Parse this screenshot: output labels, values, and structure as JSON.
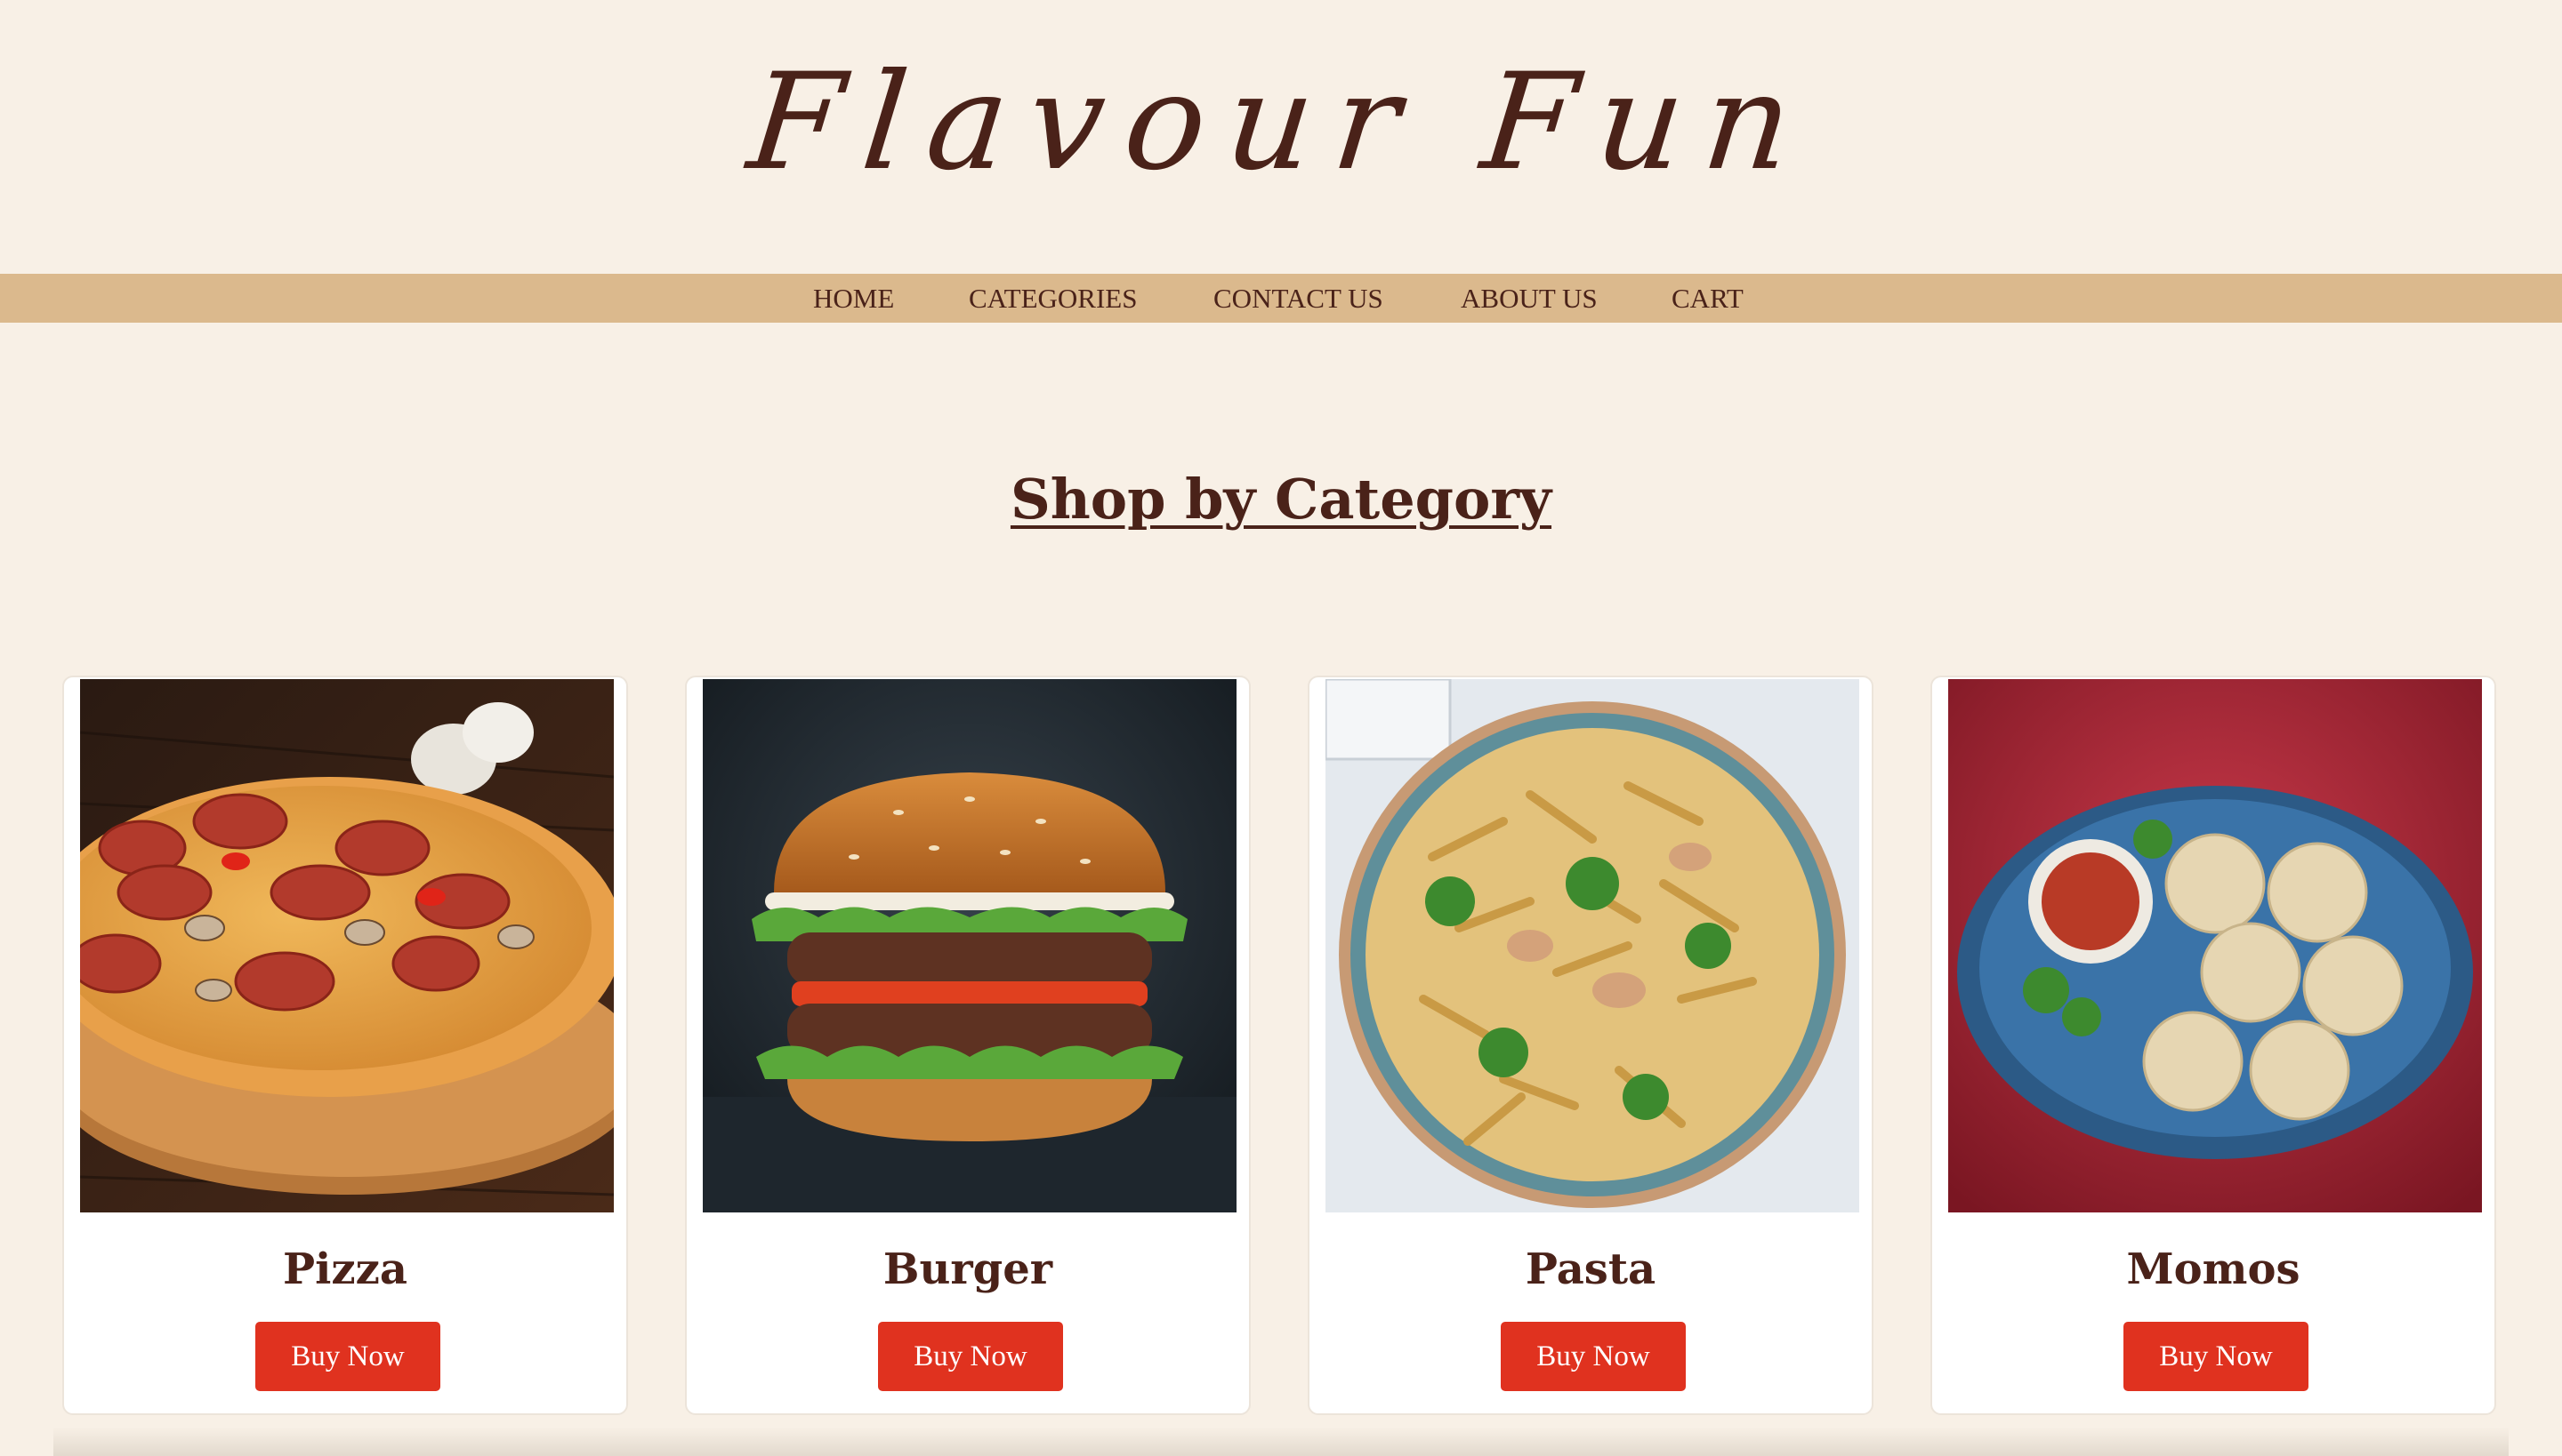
{
  "brand": {
    "title": "Flavour Fun"
  },
  "nav": {
    "items": [
      {
        "label": "HOME"
      },
      {
        "label": "CATEGORIES"
      },
      {
        "label": "CONTACT US"
      },
      {
        "label": "ABOUT US"
      },
      {
        "label": "CART"
      }
    ]
  },
  "main": {
    "section_title": "Shop by Category",
    "categories": [
      {
        "name": "Pizza",
        "button_label": "Buy Now",
        "image": "pizza-image"
      },
      {
        "name": "Burger",
        "button_label": "Buy Now",
        "image": "burger-image"
      },
      {
        "name": "Pasta",
        "button_label": "Buy Now",
        "image": "pasta-image"
      },
      {
        "name": "Momos",
        "button_label": "Buy Now",
        "image": "momos-image"
      }
    ]
  },
  "colors": {
    "background": "#f8f0e6",
    "nav_bar": "#dbb98d",
    "text_brown": "#4a2219",
    "button_red": "#e0321f"
  }
}
